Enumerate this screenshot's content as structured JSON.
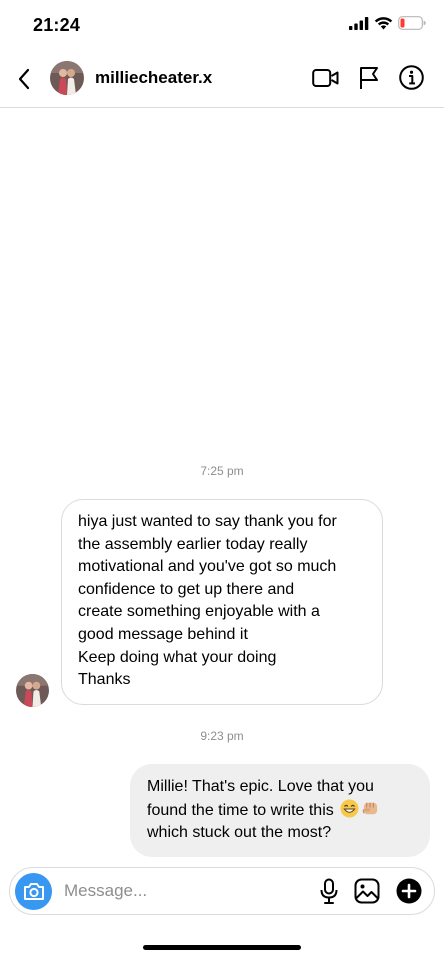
{
  "status_bar": {
    "time": "21:24",
    "icons": [
      "signal-icon",
      "wifi-icon",
      "battery-low-icon"
    ]
  },
  "header": {
    "back_icon": "chevron-left-icon",
    "username": "milliecheater.x",
    "actions": [
      "video-call-icon",
      "flag-icon",
      "info-icon"
    ]
  },
  "conversation": {
    "messages": [
      {
        "timestamp": "7:25 pm",
        "direction": "incoming",
        "lines": [
          "hiya just wanted to say thank you for",
          "the assembly earlier today really",
          "motivational and you've got so much",
          "confidence to get up there and",
          "create something enjoyable with a",
          "good message behind it",
          "Keep doing what your doing",
          "Thanks"
        ]
      },
      {
        "timestamp": "9:23 pm",
        "direction": "outgoing",
        "lines": [
          "Millie! That's epic. Love that you",
          "found the time to write this",
          "which stuck out the most?"
        ],
        "emojis": [
          "grinning-face-emoji",
          "fist-bump-emoji"
        ]
      }
    ]
  },
  "composer": {
    "placeholder": "Message...",
    "value": "",
    "icons": [
      "camera-icon",
      "microphone-icon",
      "gallery-icon",
      "plus-circle-icon"
    ]
  },
  "colors": {
    "accent": "#3897f0",
    "outgoing_bubble": "#efefef",
    "border": "#dbdbdb",
    "muted_text": "#8e8e8e",
    "battery_low": "#ff3b30"
  }
}
